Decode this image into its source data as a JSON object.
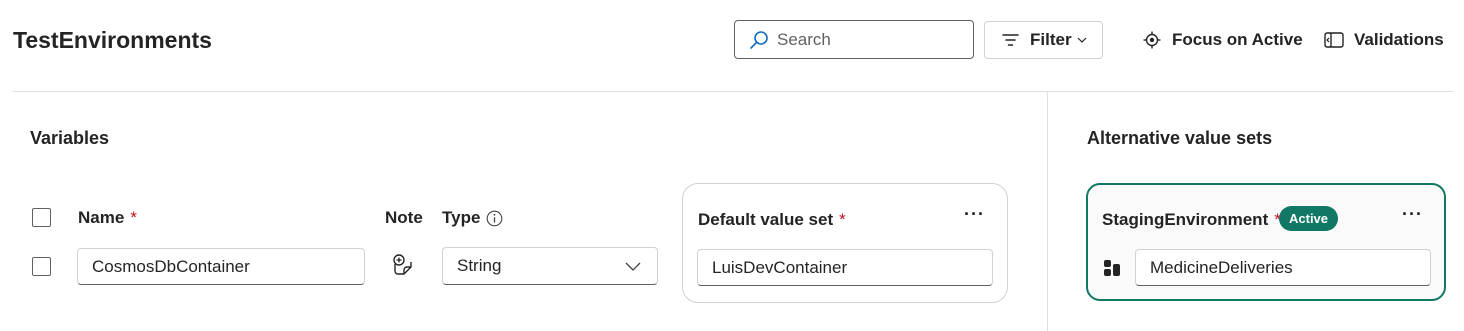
{
  "header": {
    "title": "TestEnvironments",
    "search_placeholder": "Search",
    "filter_label": "Filter",
    "focus_label": "Focus on Active",
    "validations_label": "Validations"
  },
  "variables": {
    "section_title": "Variables",
    "columns": {
      "name": "Name",
      "note": "Note",
      "type": "Type",
      "required_marker": "*"
    },
    "rows": [
      {
        "name": "CosmosDbContainer",
        "type": "String"
      }
    ]
  },
  "default_value_set": {
    "title": "Default value set",
    "required_marker": "*",
    "more": "···",
    "values": [
      "LuisDevContainer"
    ]
  },
  "alternative_value_sets": {
    "section_title": "Alternative value sets",
    "sets": [
      {
        "name": "StagingEnvironment",
        "required_marker": "*",
        "badge": "Active",
        "more": "···",
        "values": [
          "MedicineDeliveries"
        ]
      }
    ]
  },
  "colors": {
    "accent": "#117865",
    "required": "#c50f1f",
    "divider": "#e0e0e0"
  },
  "icons": {
    "search": "search-icon",
    "filter": "filter-icon",
    "focus": "target-icon",
    "validations": "panel-icon",
    "info": "info-icon",
    "note": "add-note-icon",
    "dropdown": "chevron-down-icon",
    "value_type": "blocks-icon"
  }
}
